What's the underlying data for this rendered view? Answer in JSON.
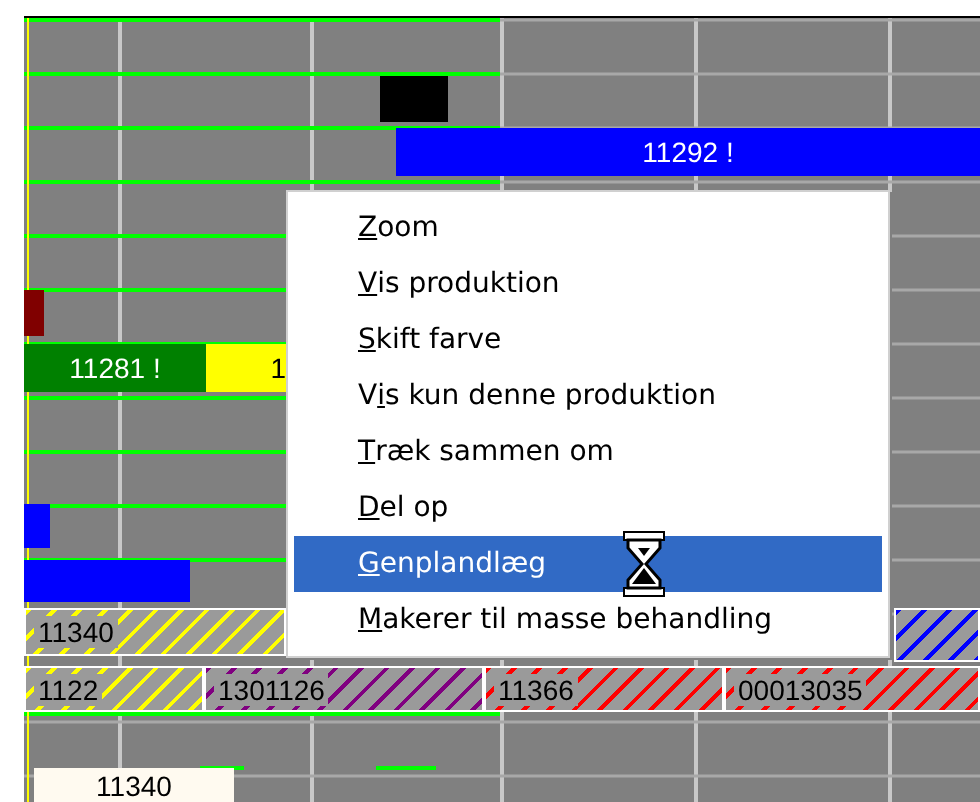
{
  "gantt": {
    "bars": [
      {
        "kind": "solid",
        "color": "#000000"
      },
      {
        "kind": "solid",
        "color": "#0000ff",
        "label": "11292 !"
      },
      {
        "kind": "solid",
        "color": "#800000"
      },
      {
        "kind": "solid",
        "color": "#008000",
        "label": "11281 !"
      },
      {
        "kind": "solid",
        "color": "#ffff00",
        "label": "1"
      },
      {
        "kind": "solid",
        "color": "#0000ff"
      },
      {
        "kind": "solid",
        "color": "#0000ff"
      },
      {
        "kind": "hatched",
        "color": "#ffff00",
        "label": "11340"
      },
      {
        "kind": "hatched",
        "color": "#0000ff"
      },
      {
        "kind": "hatched",
        "color": "#ffff00",
        "label": "1122"
      },
      {
        "kind": "hatched",
        "color": "#800080",
        "label": "1301126"
      },
      {
        "kind": "hatched",
        "color": "#ff0000",
        "label": "11366"
      },
      {
        "kind": "hatched",
        "color": "#ff0000",
        "label": "00013035"
      },
      {
        "kind": "light",
        "color": "#fffaf0",
        "label": "11340"
      }
    ]
  },
  "context_menu": {
    "items": [
      {
        "mnemonic": "Z",
        "after": "oom",
        "selected": false
      },
      {
        "mnemonic": "V",
        "after": "is produktion",
        "selected": false
      },
      {
        "mnemonic": "S",
        "after": "kift farve",
        "selected": false
      },
      {
        "before": "V",
        "mnemonic": "i",
        "after": "s kun denne produktion",
        "selected": false
      },
      {
        "mnemonic": "T",
        "after": "ræk sammen om",
        "selected": false
      },
      {
        "mnemonic": "D",
        "after": "el op",
        "selected": false
      },
      {
        "mnemonic": "G",
        "after": "enplandlæg",
        "selected": true
      },
      {
        "mnemonic": "M",
        "after": "akerer til masse behandling",
        "selected": false
      }
    ]
  }
}
